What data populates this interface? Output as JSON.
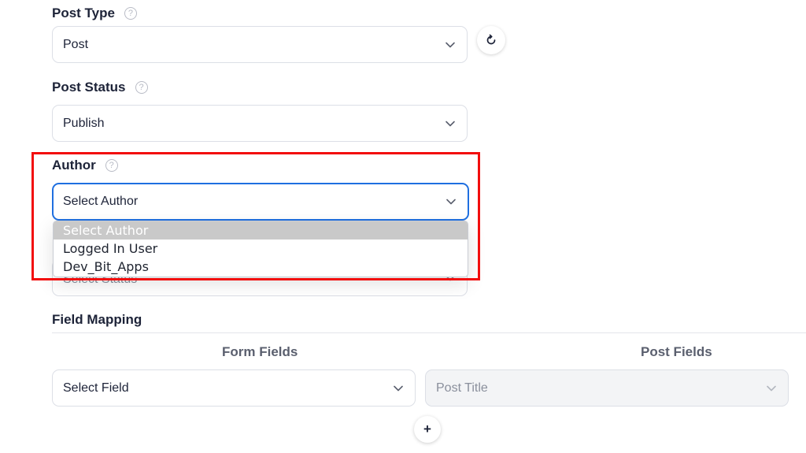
{
  "post_type": {
    "label": "Post Type",
    "help_icon": "?",
    "value": "Post",
    "refresh_icon": "↻"
  },
  "post_status": {
    "label": "Post Status",
    "help_icon": "?",
    "value": "Publish"
  },
  "author": {
    "label": "Author",
    "help_icon": "?",
    "value": "Select Author",
    "options": [
      "Select Author",
      "Logged In User",
      "Dev_Bit_Apps"
    ]
  },
  "comment_status": {
    "value": "Select Status"
  },
  "field_mapping": {
    "title": "Field Mapping",
    "form_fields_header": "Form Fields",
    "post_fields_header": "Post Fields",
    "form_field_value": "Select Field",
    "post_field_value": "Post Title",
    "add_icon": "+"
  },
  "colors": {
    "highlight": "#f20d0d",
    "focus": "#1f6fe0"
  }
}
